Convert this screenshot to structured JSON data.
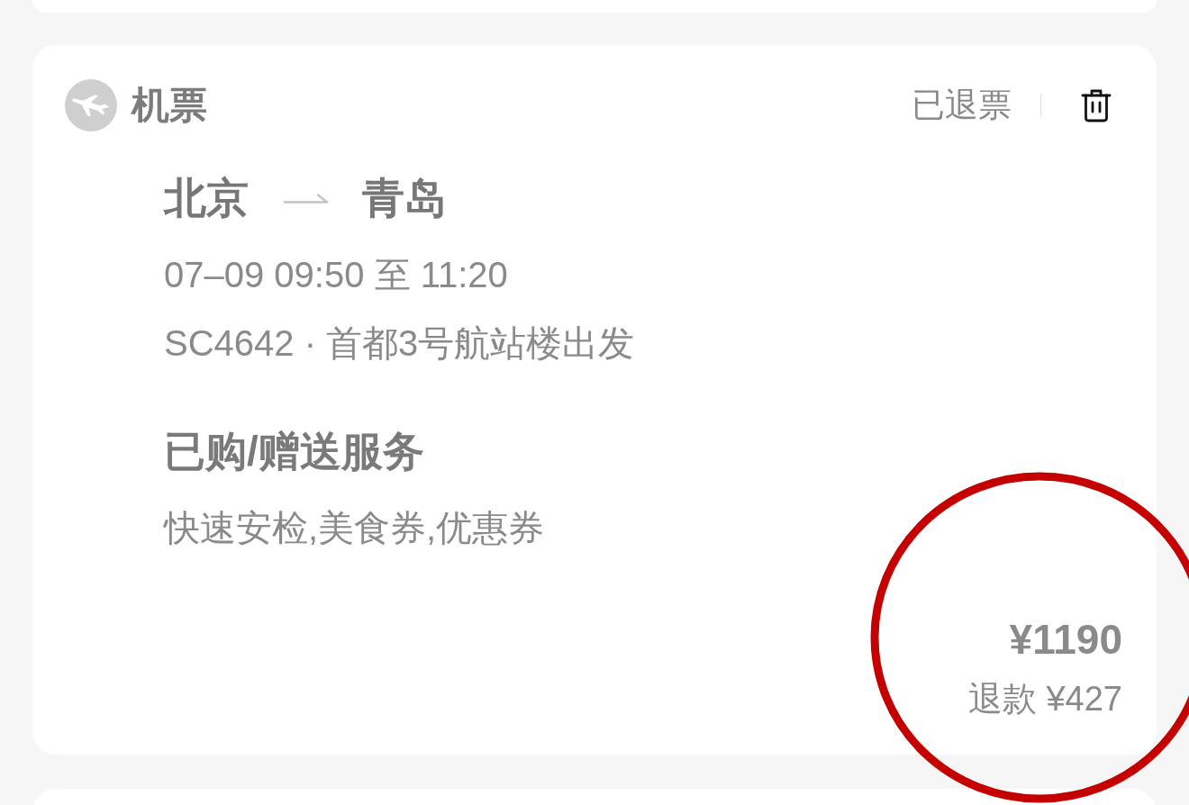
{
  "order": {
    "category": "机票",
    "status": "已退票",
    "route": {
      "from": "北京",
      "to": "青岛"
    },
    "time": "07–09 09:50 至 11:20",
    "flight": "SC4642 · 首都3号航站楼出发",
    "services_title": "已购/赠送服务",
    "services": "快速安检,美食券,优惠券",
    "price": "¥1190",
    "refund": "退款 ¥427"
  }
}
